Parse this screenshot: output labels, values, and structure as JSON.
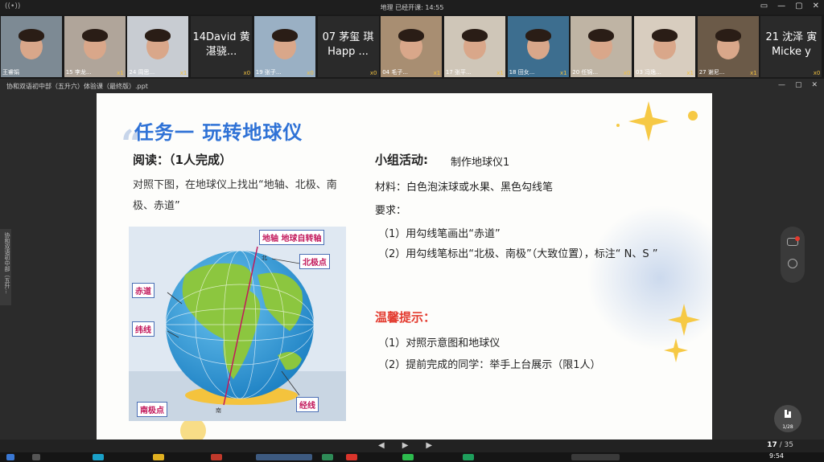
{
  "window": {
    "title": "地理   已经开课: 14:55",
    "live_icon": "((•))",
    "controls": [
      "▭",
      "—",
      "▢",
      "✕"
    ]
  },
  "participants": [
    {
      "name": "王睿娟",
      "count": "",
      "kind": "cam",
      "bg": "#7d8a94"
    },
    {
      "name": "15 李龙...",
      "count": "x1",
      "kind": "cam",
      "bg": "#b0a59a"
    },
    {
      "name": "24 周思...",
      "count": "x1",
      "kind": "cam",
      "bg": "#c8ccd2"
    },
    {
      "name": "黄湛骁...",
      "big": "14David 黄湛骁...",
      "count": "x0",
      "kind": "text",
      "bg": "#2a2a2a"
    },
    {
      "name": "19 张子...",
      "count": "x0",
      "kind": "cam",
      "bg": "#9ab0c4"
    },
    {
      "name": "茅琪",
      "big": "07 茅玺 琪Happ ...",
      "count": "x0",
      "kind": "text",
      "bg": "#2a2a2a"
    },
    {
      "name": "04 毛子...",
      "count": "x1",
      "kind": "cam",
      "bg": "#a88e72"
    },
    {
      "name": "17 张平...",
      "count": "x1",
      "kind": "cam",
      "bg": "#cfc6b8"
    },
    {
      "name": "18 田女...",
      "count": "x1",
      "kind": "cam",
      "bg": "#3d6e8f"
    },
    {
      "name": "20 任锦...",
      "count": "x0",
      "kind": "cam",
      "bg": "#bfb4a4"
    },
    {
      "name": "03 冯逸...",
      "count": "x1",
      "kind": "cam",
      "bg": "#d8cdbf"
    },
    {
      "name": "27 谢尼...",
      "count": "x1",
      "kind": "cam",
      "bg": "#6b5a48"
    },
    {
      "name": "沈泽寅",
      "big": "21 沈泽 寅Micke y",
      "count": "x0",
      "kind": "text",
      "bg": "#2a2a2a"
    }
  ],
  "file": {
    "name": "协和双语初中部（五升六）体验课（最终版）.ppt",
    "side_tab": "协和双语初中部（五升..."
  },
  "slide": {
    "title": "任务一   玩转地球仪",
    "read_heading": "阅读：（1人完成）",
    "read_text": "对照下图，在地球仪上找出“地轴、北极、南极、赤道”",
    "group_heading": "小组活动:",
    "group_title": "制作地球仪1",
    "materials": "材料：白色泡沫球或水果、黑色勾线笔",
    "require": "要求：",
    "req1": "（1）用勾线笔画出“赤道”",
    "req2": "（2）用勾线笔标出“北极、南极”（大致位置），标注“ N、S ”",
    "tip_heading": "温馨提示：",
    "tip1": "（1）对照示意图和地球仪",
    "tip2": "（2）提前完成的同学：举手上台展示（限1人）",
    "globe_labels": {
      "axis": "地轴  地球自转轴",
      "north": "北极点",
      "equator": "赤道",
      "latitude": "纬线",
      "south": "南极点",
      "longitude": "经线",
      "n": "北",
      "s": "南"
    }
  },
  "pager": {
    "current": "17",
    "sep": " / ",
    "total": "35",
    "badge_top": "1/28",
    "prev": "◀",
    "play": "▶",
    "next": "▶"
  },
  "taskbar": {
    "time": "9:54"
  },
  "colors": {
    "title_blue": "#2f72d6",
    "warn_red": "#e33a2e",
    "ocean": "#2fa0dc",
    "land": "#8cc63f"
  }
}
